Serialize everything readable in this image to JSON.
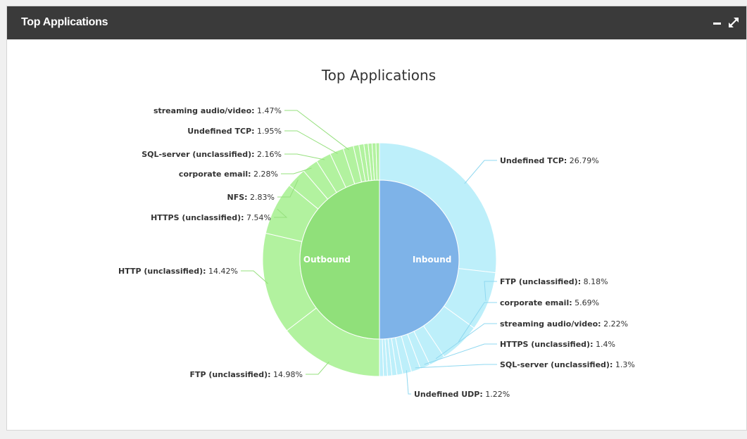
{
  "widget": {
    "title": "Top Applications",
    "minimize_icon": "minimize-icon",
    "expand_icon": "expand-icon"
  },
  "colors": {
    "header_bg": "#3a3a3a",
    "outbound_inner": "#90e07a",
    "outbound_outer": "#b2f29f",
    "inbound_inner": "#7eb3e8",
    "inbound_outer": "#bdeffa"
  },
  "chart_data": {
    "type": "pie",
    "variant": "donut-with-inner-pie",
    "title": "Top Applications",
    "inner": [
      {
        "name": "Outbound",
        "value": 50
      },
      {
        "name": "Inbound",
        "value": 50
      }
    ],
    "outer": [
      {
        "group": "Inbound",
        "name": "Undefined TCP",
        "value": 26.79
      },
      {
        "group": "Inbound",
        "name": "FTP (unclassified)",
        "value": 8.18
      },
      {
        "group": "Inbound",
        "name": "corporate email",
        "value": 5.69
      },
      {
        "group": "Inbound",
        "name": "streaming audio/video",
        "value": 2.22
      },
      {
        "group": "Inbound",
        "name": "HTTPS (unclassified)",
        "value": 1.4
      },
      {
        "group": "Inbound",
        "name": "SQL-server (unclassified)",
        "value": 1.3
      },
      {
        "group": "Inbound",
        "name": "Undefined UDP",
        "value": 1.22
      },
      {
        "group": "Inbound",
        "value": 0.8
      },
      {
        "group": "Inbound",
        "value": 0.7
      },
      {
        "group": "Inbound",
        "value": 0.6
      },
      {
        "group": "Inbound",
        "value": 0.55
      },
      {
        "group": "Inbound",
        "value": 0.55
      },
      {
        "group": "Outbound",
        "name": "FTP (unclassified)",
        "value": 14.98
      },
      {
        "group": "Outbound",
        "name": "HTTP (unclassified)",
        "value": 14.42
      },
      {
        "group": "Outbound",
        "name": "HTTPS (unclassified)",
        "value": 7.54
      },
      {
        "group": "Outbound",
        "name": "NFS",
        "value": 2.83
      },
      {
        "group": "Outbound",
        "name": "corporate email",
        "value": 2.28
      },
      {
        "group": "Outbound",
        "name": "SQL-server (unclassified)",
        "value": 2.16
      },
      {
        "group": "Outbound",
        "name": "Undefined TCP",
        "value": 1.95
      },
      {
        "group": "Outbound",
        "name": "streaming audio/video",
        "value": 1.47
      },
      {
        "group": "Outbound",
        "value": 0.8
      },
      {
        "group": "Outbound",
        "value": 0.7
      },
      {
        "group": "Outbound",
        "value": 0.6
      },
      {
        "group": "Outbound",
        "value": 0.55
      },
      {
        "group": "Outbound",
        "value": 0.55
      },
      {
        "group": "Outbound",
        "value": 0.5
      }
    ]
  }
}
